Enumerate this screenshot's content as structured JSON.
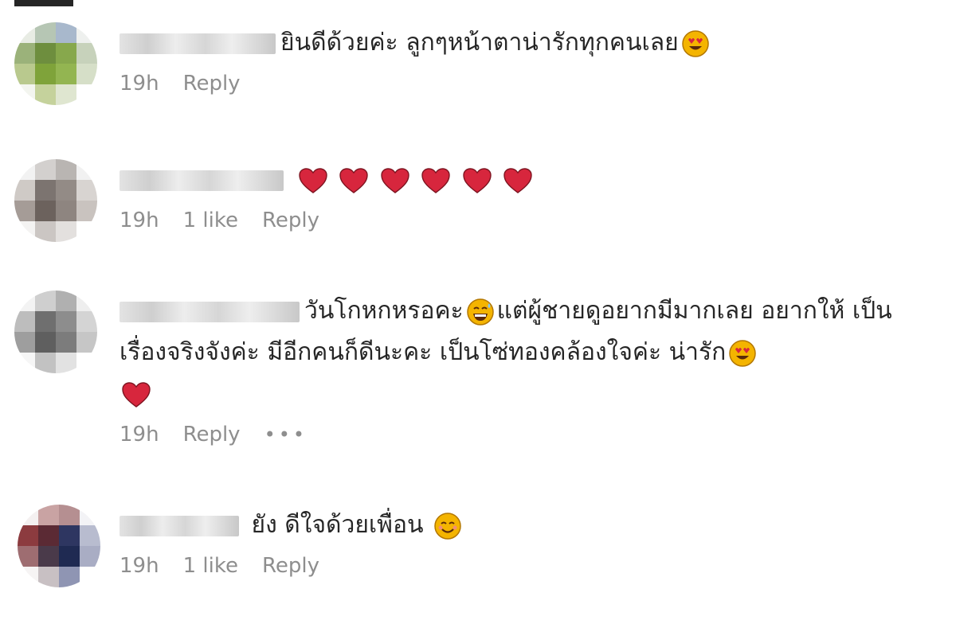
{
  "comments": [
    {
      "text": "ยินดีด้วยค่ะ ลูกๆหน้าตาน่ารักทุกคนเลย",
      "emoji_after": [
        "heart-eyes"
      ],
      "time": "19h",
      "likes": "",
      "reply": "Reply",
      "more": ""
    },
    {
      "text": "",
      "emoji_after": [
        "heart",
        "heart",
        "heart",
        "heart",
        "heart",
        "heart"
      ],
      "time": "19h",
      "likes": "1 like",
      "reply": "Reply",
      "more": ""
    },
    {
      "text_a": "วันโกหกหรอคะ",
      "emoji_mid": "grinning-sweat",
      "text_b": "แต่ผู้ชายดูอยากมีมากเลย อยากให้ เป็นเรื่องจริงจังค่ะ มีอีกคนก็ดีนะคะ เป็นโซ่ทองคล้องใจค่ะ น่ารัก",
      "emoji_after": [
        "heart-eyes",
        "heart"
      ],
      "time": "19h",
      "likes": "",
      "reply": "Reply",
      "more": "•••"
    },
    {
      "text": "ยัง ดีใจด้วยเพื่อน",
      "emoji_after": [
        "smiling-face"
      ],
      "time": "19h",
      "likes": "1 like",
      "reply": "Reply",
      "more": ""
    }
  ],
  "colors": {
    "heart": "#d7263d",
    "emoji_face": "#f4b400",
    "meta_text": "#8e8e8e"
  }
}
